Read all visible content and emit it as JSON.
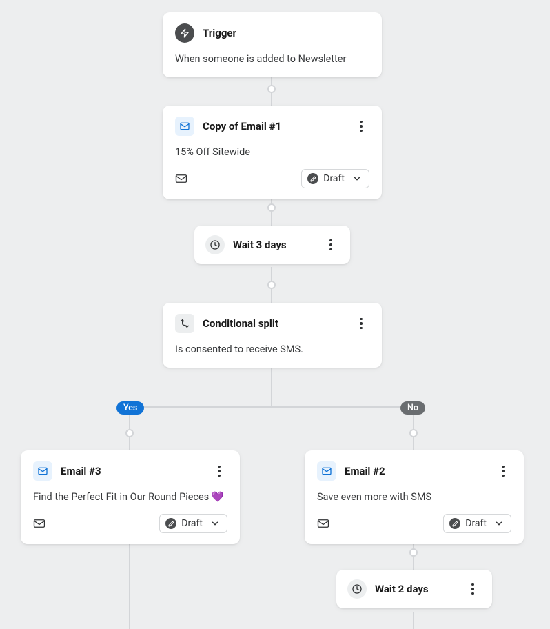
{
  "trigger": {
    "title": "Trigger",
    "desc": "When someone is added to Newsletter"
  },
  "email1": {
    "title": "Copy of Email #1",
    "desc": "15% Off Sitewide",
    "status": "Draft"
  },
  "wait1": {
    "title": "Wait 3 days"
  },
  "split": {
    "title": "Conditional split",
    "desc": "Is consented to receive SMS."
  },
  "branches": {
    "yes": "Yes",
    "no": "No"
  },
  "email3": {
    "title": "Email #3",
    "desc": "Find the Perfect Fit in Our Round Pieces 💜",
    "status": "Draft"
  },
  "email2": {
    "title": "Email #2",
    "desc": "Save even more with SMS",
    "status": "Draft"
  },
  "wait2": {
    "title": "Wait 2 days"
  }
}
